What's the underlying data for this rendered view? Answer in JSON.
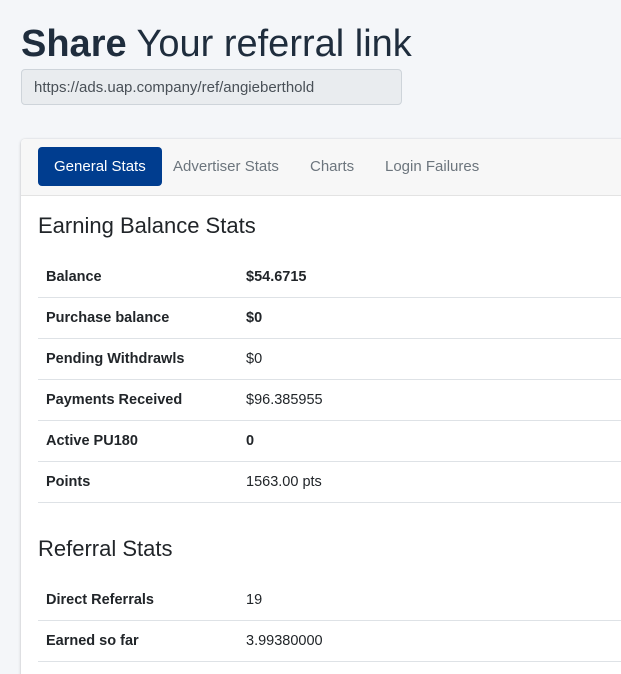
{
  "header": {
    "title_strong": "Share",
    "title_rest": " Your referral link",
    "referral_link": "https://ads.uap.company/ref/angieberthold"
  },
  "tabs": [
    {
      "label": "General Stats",
      "active": true
    },
    {
      "label": "Advertiser Stats",
      "active": false
    },
    {
      "label": "Charts",
      "active": false
    },
    {
      "label": "Login Failures",
      "active": false
    }
  ],
  "earning": {
    "title": "Earning Balance Stats",
    "rows": [
      {
        "label": "Balance",
        "value": "$54.6715"
      },
      {
        "label": "Purchase balance",
        "value": "$0"
      },
      {
        "label": "Pending Withdrawls",
        "value": "$0"
      },
      {
        "label": "Payments Received",
        "value": "$96.385955"
      },
      {
        "label": "Active PU180",
        "value": "0"
      },
      {
        "label": "Points",
        "value": "1563.00 pts"
      }
    ]
  },
  "referral": {
    "title": "Referral Stats",
    "rows": [
      {
        "label": "Direct Referrals",
        "value": "19"
      },
      {
        "label": "Earned so far",
        "value": "3.99380000"
      }
    ]
  },
  "colors": {
    "active_tab": "#003d8f",
    "background": "#f4f6f9"
  }
}
